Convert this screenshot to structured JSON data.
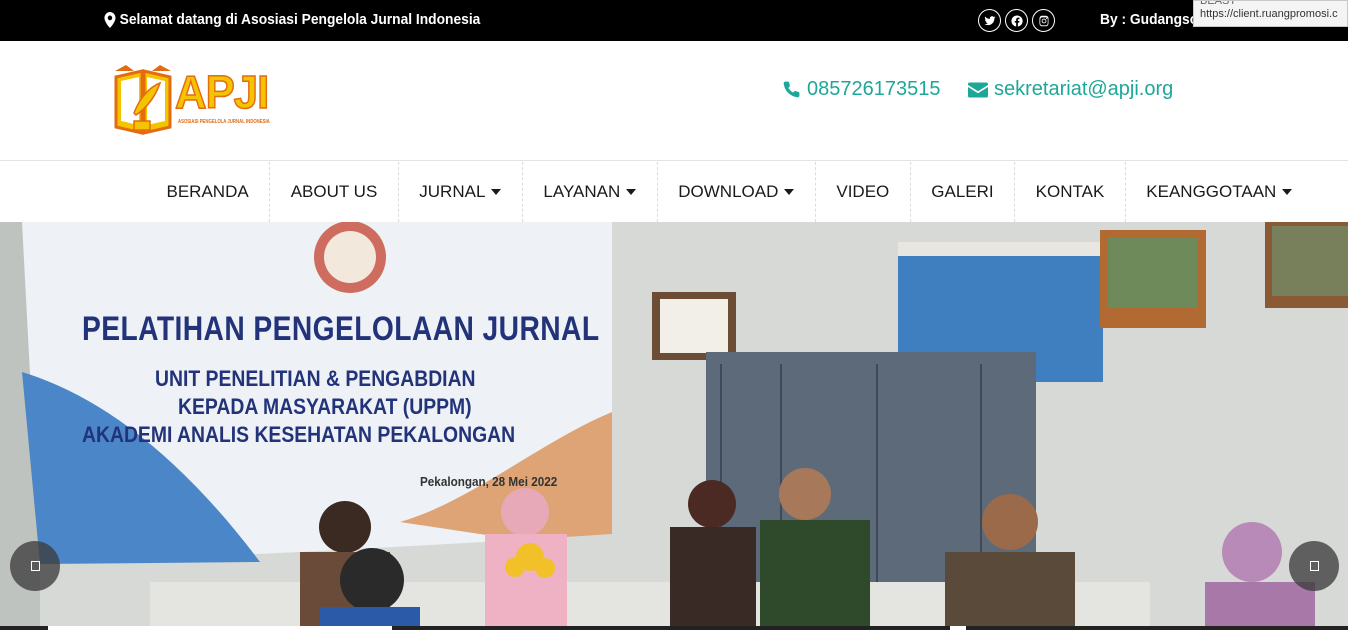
{
  "topbar": {
    "welcome_text": "Selamat datang di Asosiasi Pengelola Jurnal Indonesia",
    "byline_text": "By : Gudangsoft",
    "socials": [
      {
        "name": "twitter-icon"
      },
      {
        "name": "facebook-icon"
      },
      {
        "name": "instagram-icon"
      }
    ],
    "tooltip_top": "BEAST",
    "tooltip_url": "https://client.ruangpromosi.c"
  },
  "header": {
    "logo_title": "APJI",
    "logo_subtitle": "ASOSIASI PENGELOLA JURNAL INDONESIA",
    "phone": "085726173515",
    "email": "sekretariat@apji.org"
  },
  "nav": {
    "items": [
      {
        "label": "BERANDA",
        "dropdown": false
      },
      {
        "label": "ABOUT US",
        "dropdown": false
      },
      {
        "label": "JURNAL",
        "dropdown": true
      },
      {
        "label": "LAYANAN",
        "dropdown": true
      },
      {
        "label": "DOWNLOAD",
        "dropdown": true
      },
      {
        "label": "VIDEO",
        "dropdown": false
      },
      {
        "label": "GALERI",
        "dropdown": false
      },
      {
        "label": "KONTAK",
        "dropdown": false
      },
      {
        "label": "KEANGGOTAAN",
        "dropdown": true
      }
    ]
  },
  "slider": {
    "banner_line1": "PELATIHAN PENGELOLAAN JURNAL",
    "banner_line2": "UNIT PENELITIAN & PENGABDIAN",
    "banner_line3": "KEPADA MASYARAKAT (UPPM)",
    "banner_line4": "AKADEMI ANALIS KESEHATAN PEKALONGAN",
    "banner_line5": "Pekalongan, 28 Mei 2022"
  },
  "colors": {
    "topbar_bg": "#000000",
    "accent": "#1ea798",
    "logo_yellow": "#f5c400",
    "logo_orange": "#e36b12"
  }
}
